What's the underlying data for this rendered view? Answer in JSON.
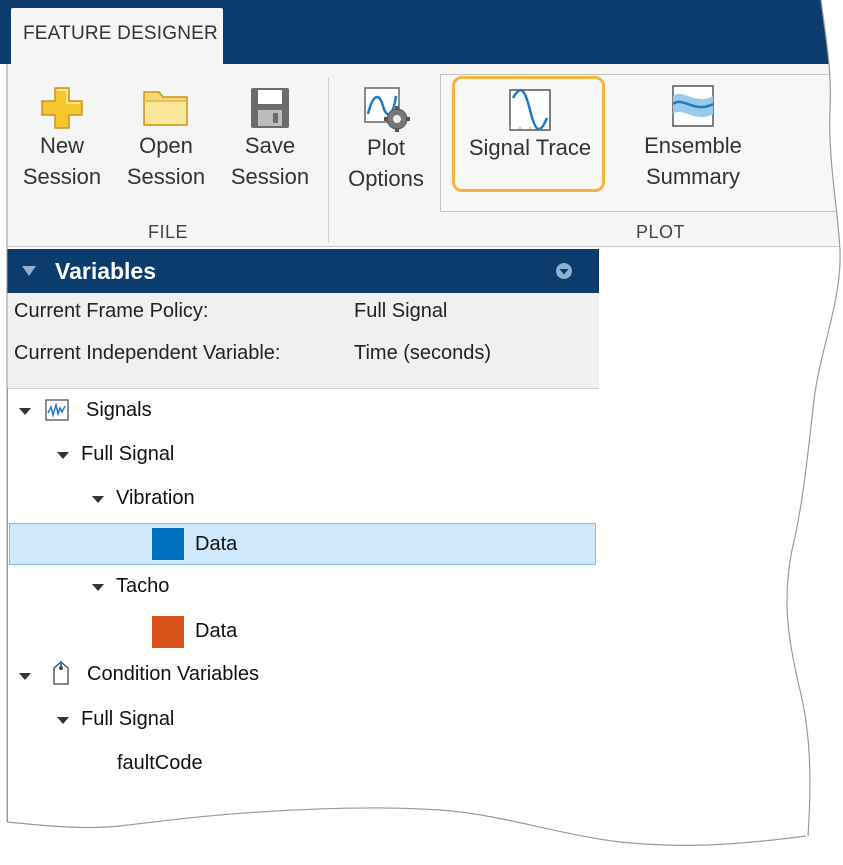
{
  "toolstrip": {
    "tab_label": "FEATURE DESIGNER",
    "file_group": {
      "label": "FILE",
      "new_session": {
        "line1": "New",
        "line2": "Session"
      },
      "open_session": {
        "line1": "Open",
        "line2": "Session"
      },
      "save_session": {
        "line1": "Save",
        "line2": "Session"
      }
    },
    "plot_group": {
      "label": "PLOT",
      "plot_options": {
        "line1": "Plot",
        "line2": "Options"
      },
      "signal_trace": {
        "line1": "Signal Trace"
      },
      "ensemble_summary": {
        "line1": "Ensemble",
        "line2": "Summary"
      }
    }
  },
  "variables_panel": {
    "title": "Variables",
    "info": {
      "frame_policy_label": "Current Frame Policy:",
      "frame_policy_value": "Full Signal",
      "indep_var_label": "Current Independent Variable:",
      "indep_var_value": "Time (seconds)"
    },
    "tree": {
      "signals": "Signals",
      "signals_full": "Full Signal",
      "vibration": "Vibration",
      "vibration_data": "Data",
      "tacho": "Tacho",
      "tacho_data": "Data",
      "condition_vars": "Condition Variables",
      "condition_full": "Full Signal",
      "fault_code": "faultCode"
    },
    "colors": {
      "vibration": "#0072bd",
      "tacho": "#d95319",
      "selection": "#cfe8fb",
      "header": "#0c3c6e",
      "highlight": "#f5b43b"
    }
  }
}
